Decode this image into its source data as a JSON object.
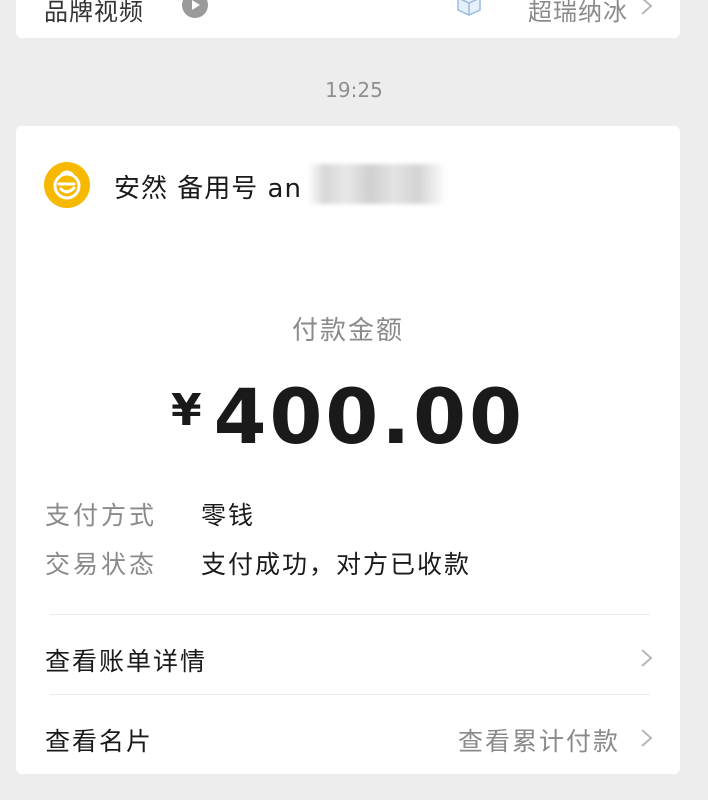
{
  "prev_card": {
    "left_text": "品牌视频",
    "right_text": "超瑞纳冰"
  },
  "timestamp": "19:25",
  "merchant": {
    "name": "安然 备用号 an"
  },
  "payment": {
    "amount_label": "付款金额",
    "currency": "¥",
    "amount": "400.00",
    "method_key": "支付方式",
    "method_value": "零钱",
    "status_key": "交易状态",
    "status_value": "支付成功，对方已收款"
  },
  "links": {
    "bill_details": "查看账单详情",
    "business_card": "查看名片",
    "cumulative_payment": "查看累计付款"
  },
  "colors": {
    "background": "#ededed",
    "card": "#ffffff",
    "logo": "#f6b800",
    "muted_text": "#8a8a8a"
  }
}
